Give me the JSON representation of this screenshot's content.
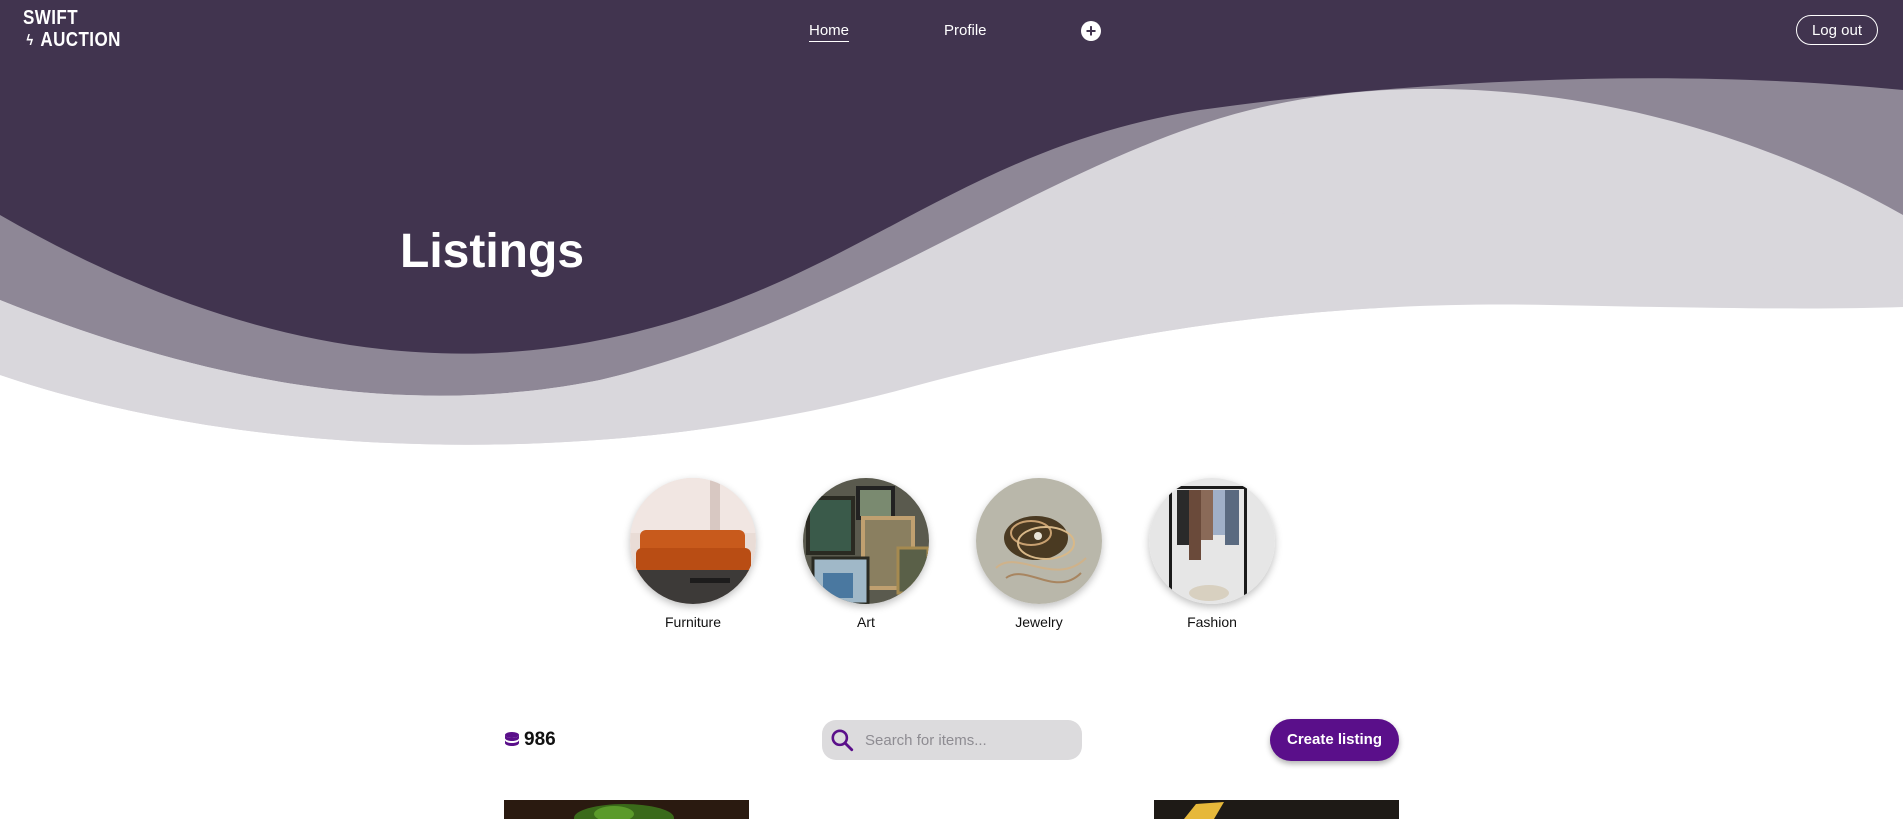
{
  "header": {
    "logo_line1": "SWIFT",
    "logo_line2": "AUCTION",
    "nav": [
      {
        "label": "Home"
      },
      {
        "label": "Profile"
      }
    ],
    "add_icon": "plus-circle-icon",
    "logout_label": "Log out"
  },
  "hero": {
    "title": "Listings"
  },
  "categories": [
    {
      "label": "Furniture"
    },
    {
      "label": "Art"
    },
    {
      "label": "Jewelry"
    },
    {
      "label": "Fashion"
    }
  ],
  "toolbar": {
    "credits_icon": "coins-icon",
    "credits": "986",
    "search_placeholder": "Search for items...",
    "search_icon": "search-icon",
    "create_label": "Create listing"
  },
  "colors": {
    "header_bg": "#41344f",
    "wave_mid": "#8e8796",
    "wave_light": "#d9d7dc",
    "accent": "#5a0f8a"
  }
}
